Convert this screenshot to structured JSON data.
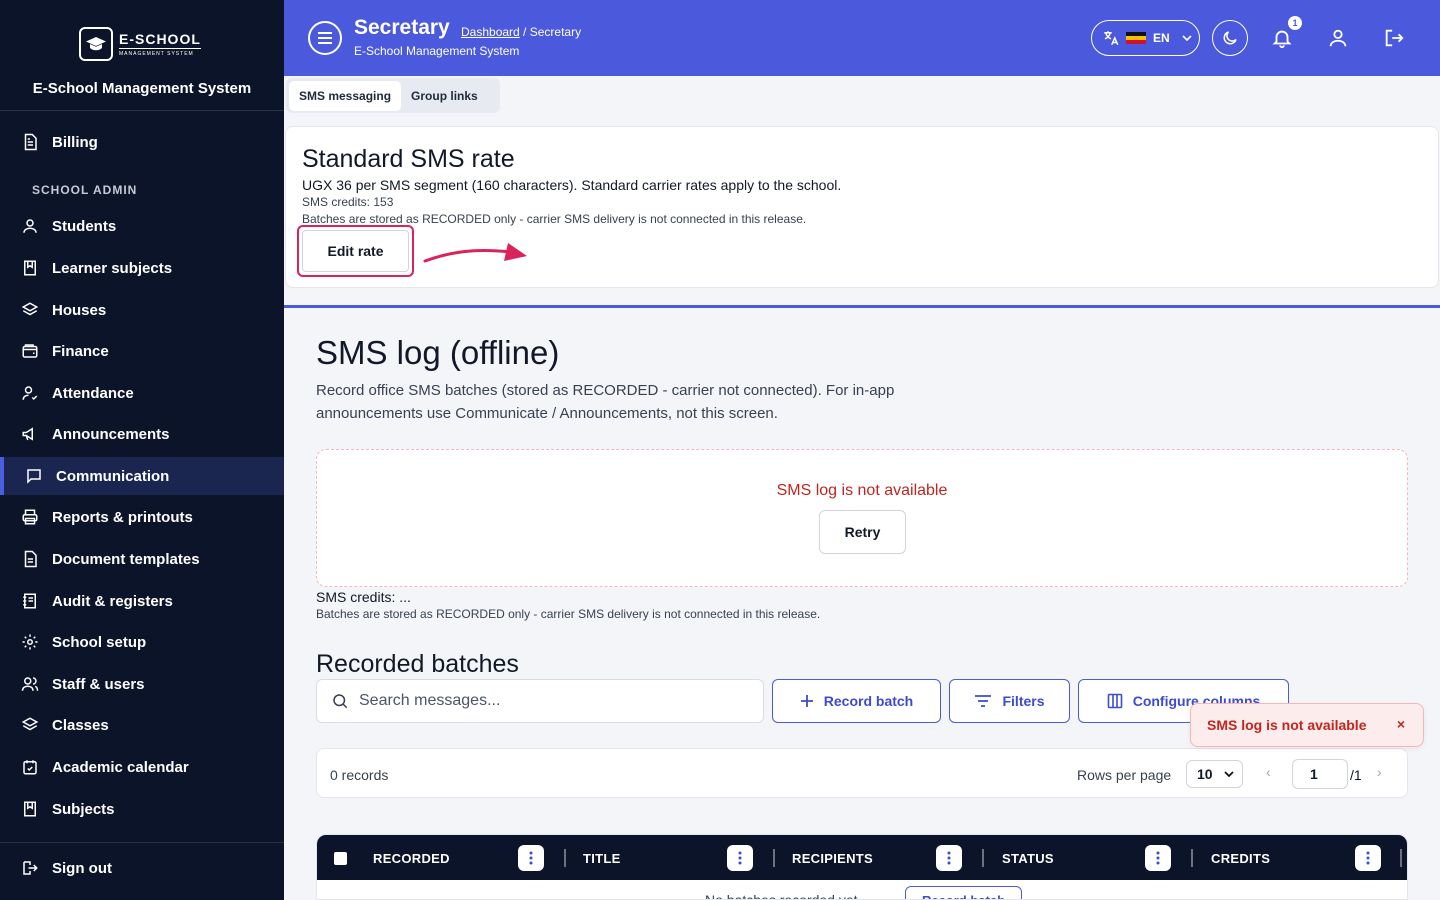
{
  "colors": {
    "sidebar_bg": "#0c1429",
    "header_bg": "#4b59dc",
    "accent": "#4b59dc",
    "error": "#c0261f",
    "highlight": "#d9235a"
  },
  "brand": {
    "logo_main": "E-SCHOOL",
    "logo_sub": "MANAGEMENT SYSTEM",
    "system_name": "E-School Management System"
  },
  "sidebar": {
    "items_top": [
      {
        "label": "Billing",
        "icon": "document-icon"
      }
    ],
    "section_label": "SCHOOL ADMIN",
    "items": [
      {
        "label": "Students",
        "icon": "user-icon"
      },
      {
        "label": "Learner subjects",
        "icon": "book-icon"
      },
      {
        "label": "Houses",
        "icon": "layers-icon"
      },
      {
        "label": "Finance",
        "icon": "wallet-icon"
      },
      {
        "label": "Attendance",
        "icon": "user-check-icon"
      },
      {
        "label": "Announcements",
        "icon": "megaphone-icon"
      },
      {
        "label": "Communication",
        "icon": "chat-icon",
        "active": true
      },
      {
        "label": "Reports & printouts",
        "icon": "printer-icon"
      },
      {
        "label": "Document templates",
        "icon": "file-text-icon"
      },
      {
        "label": "Audit & registers",
        "icon": "register-icon"
      },
      {
        "label": "School setup",
        "icon": "gear-icon"
      },
      {
        "label": "Staff & users",
        "icon": "users-icon"
      },
      {
        "label": "Classes",
        "icon": "layers-icon"
      },
      {
        "label": "Academic calendar",
        "icon": "calendar-icon"
      },
      {
        "label": "Subjects",
        "icon": "book-icon"
      }
    ],
    "sign_out": "Sign out"
  },
  "header": {
    "title": "Secretary",
    "breadcrumb_link": "Dashboard",
    "breadcrumb_sep": " / ",
    "breadcrumb_current": "Secretary",
    "subtitle": "E-School Management System",
    "language": "EN",
    "notification_count": "1"
  },
  "tabs": [
    {
      "label": "SMS messaging",
      "active": true
    },
    {
      "label": "Group links",
      "active": false
    }
  ],
  "rate_card": {
    "title": "Standard SMS rate",
    "description": "UGX 36 per SMS segment (160 characters). Standard carrier rates apply to the school.",
    "credits": "SMS credits: 153",
    "note": "Batches are stored as RECORDED only - carrier SMS delivery is not connected in this release.",
    "edit_label": "Edit rate"
  },
  "log": {
    "title": "SMS log (offline)",
    "description": "Record office SMS batches (stored as RECORDED - carrier not connected). For in-app announcements use Communicate / Announcements, not this screen.",
    "error_text": "SMS log is not available",
    "retry_label": "Retry",
    "credits": "SMS credits: ...",
    "note": "Batches are stored as RECORDED only - carrier SMS delivery is not connected in this release."
  },
  "batches": {
    "title": "Recorded batches",
    "search_placeholder": "Search messages...",
    "record_batch_label": "Record batch",
    "filters_label": "Filters",
    "configure_columns_label": "Configure columns",
    "records_count": "0 records",
    "rows_per_page_label": "Rows per page",
    "rows_per_page_value": "10",
    "page_current": "1",
    "page_total": "/1",
    "columns": [
      "RECORDED",
      "TITLE",
      "RECIPIENTS",
      "STATUS",
      "CREDITS"
    ],
    "empty_text": "No batches recorded yet",
    "empty_button": "Record batch"
  },
  "toast": {
    "text": "SMS log is not available",
    "close": "×"
  }
}
